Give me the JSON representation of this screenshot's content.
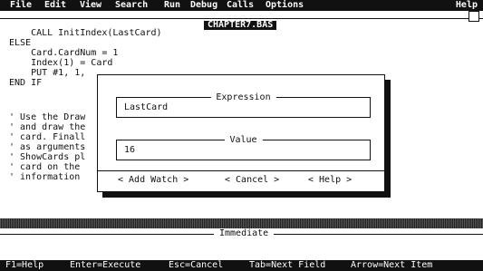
{
  "menu": {
    "items": [
      "File",
      "Edit",
      "View",
      "Search",
      "Run",
      "Debug",
      "Calls",
      "Options"
    ],
    "help": "Help"
  },
  "editor": {
    "title": "CHAPTER7.BAS",
    "lines": [
      "    CALL InitIndex(LastCard)",
      "ELSE",
      "    Card.CardNum = 1",
      "    Index(1) = Card",
      "    PUT #1, 1,",
      "END IF",
      "",
      "' Use the Draw",
      "' and draw the",
      "' card. Finall",
      "' as arguments",
      "' ShowCards pl",
      "' card on the",
      "' information"
    ]
  },
  "dialog": {
    "expression_label": "Expression",
    "expression_value": "LastCard",
    "value_label": "Value",
    "value_value": "16",
    "add_watch": "< Add Watch >",
    "cancel": "< Cancel >",
    "help": "< Help >"
  },
  "immediate": {
    "title": "Immediate"
  },
  "status": {
    "items": [
      "F1=Help",
      "Enter=Execute",
      "Esc=Cancel",
      "Tab=Next Field",
      "Arrow=Next Item"
    ]
  }
}
